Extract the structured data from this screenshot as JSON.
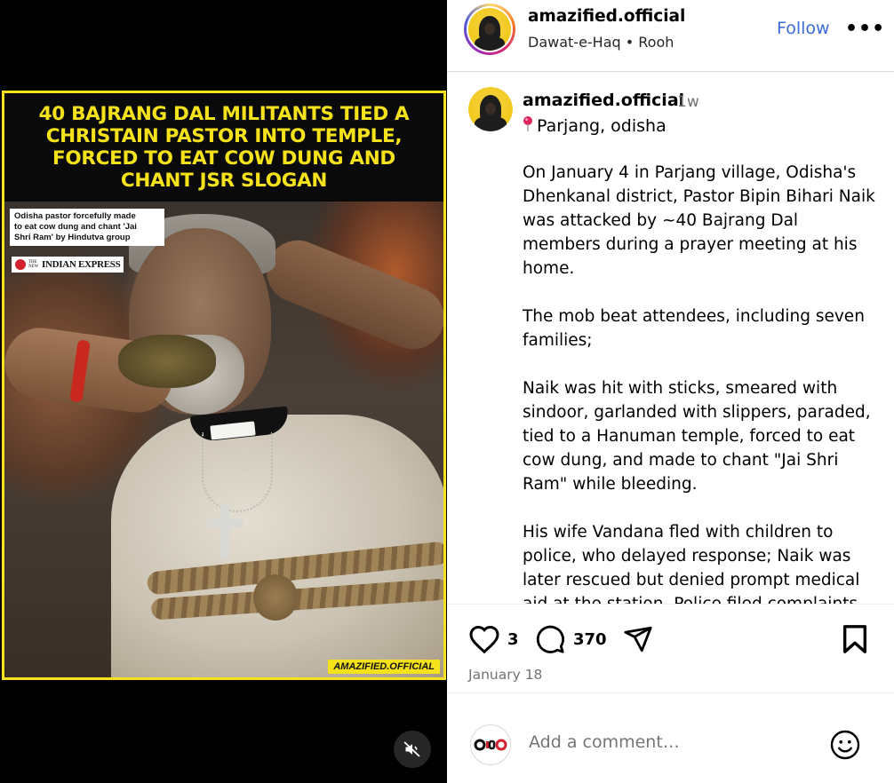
{
  "post": {
    "headline": "40 BAJRANG DAL MILITANTS TIED A CHRISTAIN PASTOR INTO TEMPLE, FORCED TO EAT COW DUNG AND CHANT JSR SLOGAN",
    "source_caption": [
      "Odisha pastor forcefully made",
      "to eat cow dung and chant 'Jai",
      "Shri Ram' by Hindutva group"
    ],
    "source_brand_small": "THE NEW",
    "source_brand": "INDIAN EXPRESS",
    "watermark": "AMAZIFIED.OFFICIAL"
  },
  "header": {
    "username": "amazified.official",
    "subtitle": "Dawat-e-Haq • Rooh",
    "follow_label": "Follow",
    "more_label": "•••"
  },
  "caption": {
    "username": "amazified.official",
    "time": "1w",
    "location_icon": "location-pin-icon",
    "location": "Parjang, odisha",
    "paragraphs": [
      "On January 4 in Parjang village, Odisha's Dhenkanal district, Pastor Bipin Bihari Naik was attacked by ~40 Bajrang Dal members during a prayer meeting at his home.",
      "The mob beat attendees, including seven families;",
      "Naik was hit with sticks, smeared with sindoor, garlanded with slippers, paraded, tied to a Hanuman temple, forced to eat cow dung, and made to chant \"Jai Shri Ram\" while bleeding.",
      "His wife Vandana fled with children to police, who delayed response; Naik was later rescued but denied prompt medical aid at the station. Police filed complaints"
    ]
  },
  "actions": {
    "like_count": "3",
    "comment_count": "370",
    "date": "January 18"
  },
  "comment": {
    "placeholder": "Add a comment…",
    "avatar_text": "OBO"
  },
  "colors": {
    "headline_yellow": "#f6e21b",
    "follow_blue": "#3a6bd8",
    "muted_text": "#737373"
  }
}
